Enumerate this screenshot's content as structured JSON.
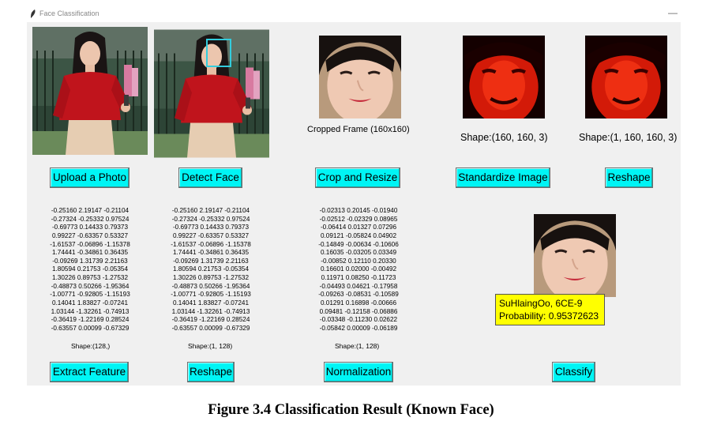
{
  "window": {
    "title": "Face Classification",
    "minimize_glyph": "—",
    "icon": "feather-icon"
  },
  "images": {
    "original": "woman-red-shirt-photo",
    "detected": "woman-red-shirt-photo-with-face-box",
    "cropped": "cropped-face",
    "standardized": "standardized-face-red",
    "reshaped": "reshaped-face-red",
    "classified": "classified-face"
  },
  "captions": {
    "cropped": "Cropped Frame (160x160)",
    "standardized_shape": "Shape:(160, 160, 3)",
    "reshaped_shape": "Shape:(1, 160, 160, 3)"
  },
  "buttons": {
    "upload": "Upload a Photo",
    "detect": "Detect Face",
    "crop": "Crop and Resize",
    "standardize": "Standardize Image",
    "reshape_top": "Reshape",
    "extract": "Extract Feature",
    "reshape_bottom": "Reshape",
    "normalize": "Normalization",
    "classify": "Classify"
  },
  "features": {
    "extracted": [
      "-0.25160 2.19147 -0.21104",
      "-0.27324 -0.25332 0.97524",
      "-0.69773 0.14433 0.79373",
      "0.99227 -0.63357 0.53327",
      "-1.61537 -0.06896 -1.15378",
      "1.74441 -0.34861 0.36435",
      "-0.09269 1.31739 2.21163",
      "1.80594 0.21753 -0.05354",
      "1.30226 0.89753 -1.27532",
      "-0.48873 0.50266 -1.95364",
      "-1.00771 -0.92805 -1.15193",
      "0.14041 1.83827 -0.07241",
      "1.03144 -1.32261 -0.74913",
      "-0.36419 -1.22169 0.28524",
      "-0.63557 0.00099 -0.67329"
    ],
    "extracted_shape": "Shape:(128,)",
    "reshaped": [
      "-0.25160 2.19147 -0.21104",
      "-0.27324 -0.25332 0.97524",
      "-0.69773 0.14433 0.79373",
      "0.99227 -0.63357 0.53327",
      "-1.61537 -0.06896 -1.15378",
      "1.74441 -0.34861 0.36435",
      "-0.09269 1.31739 2.21163",
      "1.80594 0.21753 -0.05354",
      "1.30226 0.89753 -1.27532",
      "-0.48873 0.50266 -1.95364",
      "-1.00771 -0.92805 -1.15193",
      "0.14041 1.83827 -0.07241",
      "1.03144 -1.32261 -0.74913",
      "-0.36419 -1.22169 0.28524",
      "-0.63557 0.00099 -0.67329"
    ],
    "reshaped_shape": "Shape:(1, 128)",
    "normalized": [
      "-0.02313 0.20145 -0.01940",
      "-0.02512 -0.02329 0.08965",
      "-0.06414 0.01327 0.07296",
      "0.09121 -0.05824 0.04902",
      "-0.14849 -0.00634 -0.10606",
      "0.16035 -0.03205 0.03349",
      "-0.00852 0.12110 0.20330",
      "0.16601 0.02000 -0.00492",
      "0.11971 0.08250 -0.11723",
      "-0.04493 0.04621 -0.17958",
      "-0.09263 -0.08531 -0.10589",
      "0.01291 0.16898 -0.00666",
      "0.09481 -0.12158 -0.06886",
      "-0.03348 -0.11230 0.02622",
      "-0.05842 0.00009 -0.06189"
    ],
    "normalized_shape": "Shape:(1, 128)"
  },
  "result": {
    "name": "SuHlaingOo, 6CE-9",
    "probability": "Probability: 0.95372623"
  },
  "figure_caption": "Figure 3.4 Classification Result (Known Face)",
  "colors": {
    "button": "#00f5f5",
    "result_bg": "#ffff00",
    "detect_box": "#33ccdd",
    "shirt": "#c0141c"
  }
}
